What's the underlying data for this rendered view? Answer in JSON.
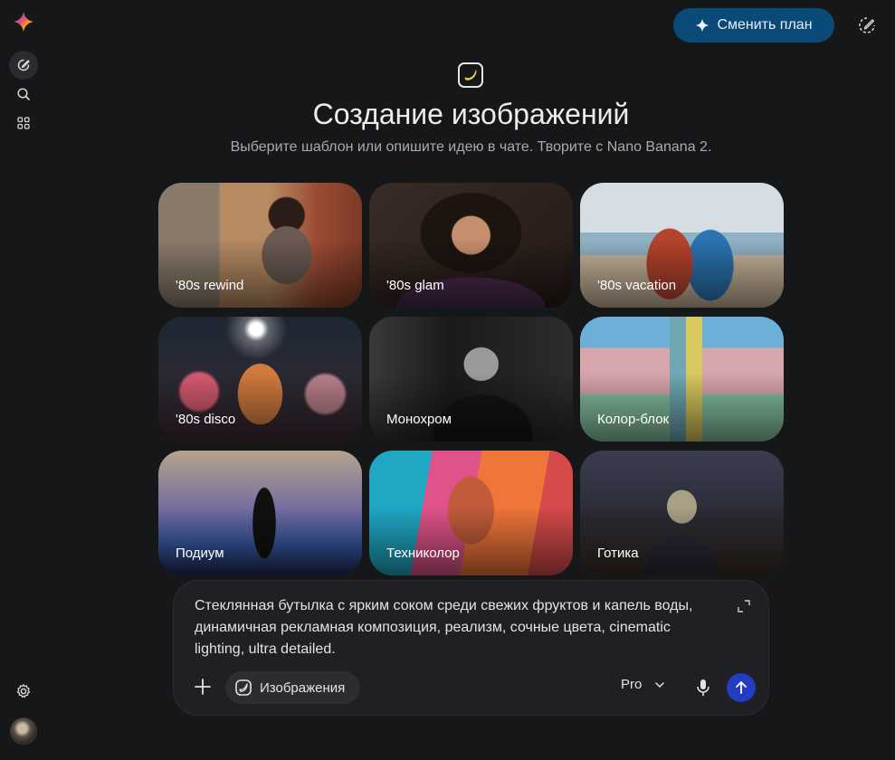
{
  "header": {
    "upgrade_label": "Сменить план"
  },
  "hero": {
    "title": "Создание изображений",
    "subtitle": "Выберите шаблон или опишите идею в чате. Творите с Nano Banana 2."
  },
  "templates": [
    {
      "label": "'80s rewind"
    },
    {
      "label": "'80s glam"
    },
    {
      "label": "'80s vacation"
    },
    {
      "label": "'80s disco"
    },
    {
      "label": "Монохром"
    },
    {
      "label": "Колор-блок"
    },
    {
      "label": "Подиум"
    },
    {
      "label": "Техниколор"
    },
    {
      "label": "Готика"
    }
  ],
  "composer": {
    "prompt_text": "Стеклянная бутылка с ярким соком среди свежих фруктов и капель воды, динамичная рекламная композиция, реализм, сочные цвета, cinematic lighting, ultra detailed.",
    "tool_chip_label": "Изображения",
    "model_label": "Pro"
  },
  "icons": {
    "logo": "gemini-sparkle-icon",
    "new_chat": "edit-icon",
    "search": "search-icon",
    "apps": "grid-icon",
    "settings": "gear-icon",
    "hero": "banana-icon",
    "send": "arrow-up-icon",
    "mic": "mic-icon"
  },
  "colors": {
    "background": "#161718",
    "upgrade_button": "#0a4a78",
    "send_button": "#233cc0",
    "composer": "#1f2023"
  }
}
